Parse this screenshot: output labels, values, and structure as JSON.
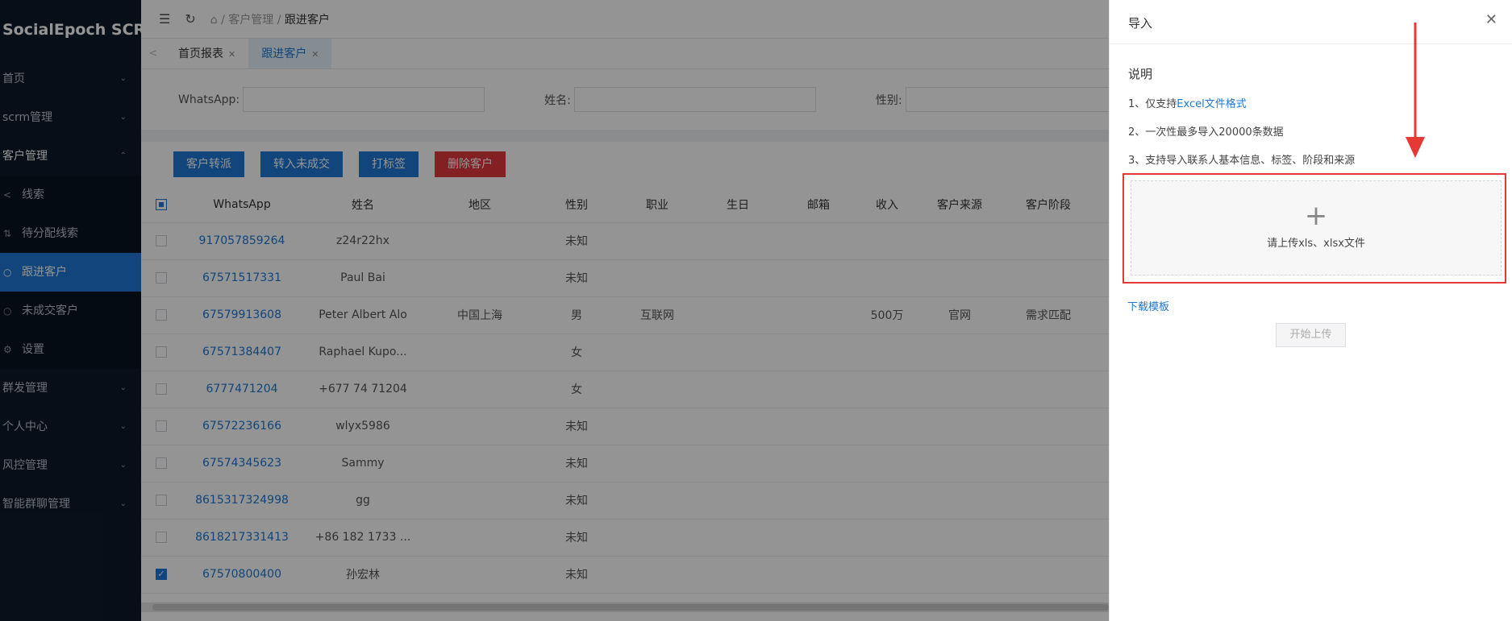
{
  "brand": "SocialEpoch SCRM",
  "sidebar": {
    "items": [
      {
        "label": "首页"
      },
      {
        "label": "scrm管理"
      },
      {
        "label": "客户管理"
      },
      {
        "label": "群发管理"
      },
      {
        "label": "个人中心"
      },
      {
        "label": "风控管理"
      },
      {
        "label": "智能群聊管理"
      }
    ],
    "sub": [
      {
        "label": "线索"
      },
      {
        "label": "待分配线索"
      },
      {
        "label": "跟进客户"
      },
      {
        "label": "未成交客户"
      },
      {
        "label": "设置"
      }
    ]
  },
  "breadcrumb": {
    "root": "客户管理",
    "current": "跟进客户",
    "sep": "/"
  },
  "tabs": [
    {
      "label": "首页报表"
    },
    {
      "label": "跟进客户"
    }
  ],
  "filters": {
    "whatsapp": "WhatsApp:",
    "name": "姓名:",
    "gender": "性别:"
  },
  "buttons": {
    "transfer": "客户转派",
    "to_unclosed": "转入未成交",
    "tag": "打标签",
    "delete": "删除客户"
  },
  "table": {
    "headers": [
      "WhatsApp",
      "姓名",
      "地区",
      "性别",
      "职业",
      "生日",
      "邮箱",
      "收入",
      "客户来源",
      "客户阶段"
    ],
    "rows": [
      {
        "wa": "917057859264",
        "name": "z24r22hx",
        "region": "",
        "gender": "未知",
        "job": "",
        "income": "",
        "source": "",
        "stage": "",
        "checked": false
      },
      {
        "wa": "67571517331",
        "name": "Paul Bai",
        "region": "",
        "gender": "未知",
        "job": "",
        "income": "",
        "source": "",
        "stage": "",
        "checked": false
      },
      {
        "wa": "67579913608",
        "name": "Peter Albert Alo",
        "region": "中国上海",
        "gender": "男",
        "job": "互联网",
        "income": "500万",
        "source": "官网",
        "stage": "需求匹配",
        "checked": false
      },
      {
        "wa": "67571384407",
        "name": "Raphael Kupo...",
        "region": "",
        "gender": "女",
        "job": "",
        "income": "",
        "source": "",
        "stage": "",
        "checked": false
      },
      {
        "wa": "6777471204",
        "name": "+677 74 71204",
        "region": "",
        "gender": "女",
        "job": "",
        "income": "",
        "source": "",
        "stage": "",
        "checked": false
      },
      {
        "wa": "67572236166",
        "name": "wlyx5986",
        "region": "",
        "gender": "未知",
        "job": "",
        "income": "",
        "source": "",
        "stage": "",
        "checked": false
      },
      {
        "wa": "67574345623",
        "name": "Sammy",
        "region": "",
        "gender": "未知",
        "job": "",
        "income": "",
        "source": "",
        "stage": "",
        "checked": false
      },
      {
        "wa": "8615317324998",
        "name": "gg",
        "region": "",
        "gender": "未知",
        "job": "",
        "income": "",
        "source": "",
        "stage": "",
        "checked": false
      },
      {
        "wa": "8618217331413",
        "name": "+86 182 1733 ...",
        "region": "",
        "gender": "未知",
        "job": "",
        "income": "",
        "source": "",
        "stage": "",
        "checked": false
      },
      {
        "wa": "67570800400",
        "name": "孙宏林",
        "region": "",
        "gender": "未知",
        "job": "",
        "income": "",
        "source": "",
        "stage": "",
        "checked": true
      }
    ]
  },
  "drawer": {
    "title": "导入",
    "notes_title": "说明",
    "note1_prefix": "1、仅支持",
    "note1_link": "Excel文件格式",
    "note2": "2、一次性最多导入20000条数据",
    "note3": "3、支持导入联系人基本信息、标签、阶段和来源",
    "upload_plus": "+",
    "upload_text": "请上传xls、xlsx文件",
    "download": "下载模板",
    "start": "开始上传"
  },
  "colors": {
    "sidebar_bg": "#0c1a29",
    "accent": "#1e78d4",
    "danger": "#e0383e",
    "highlight": "#e53935"
  }
}
